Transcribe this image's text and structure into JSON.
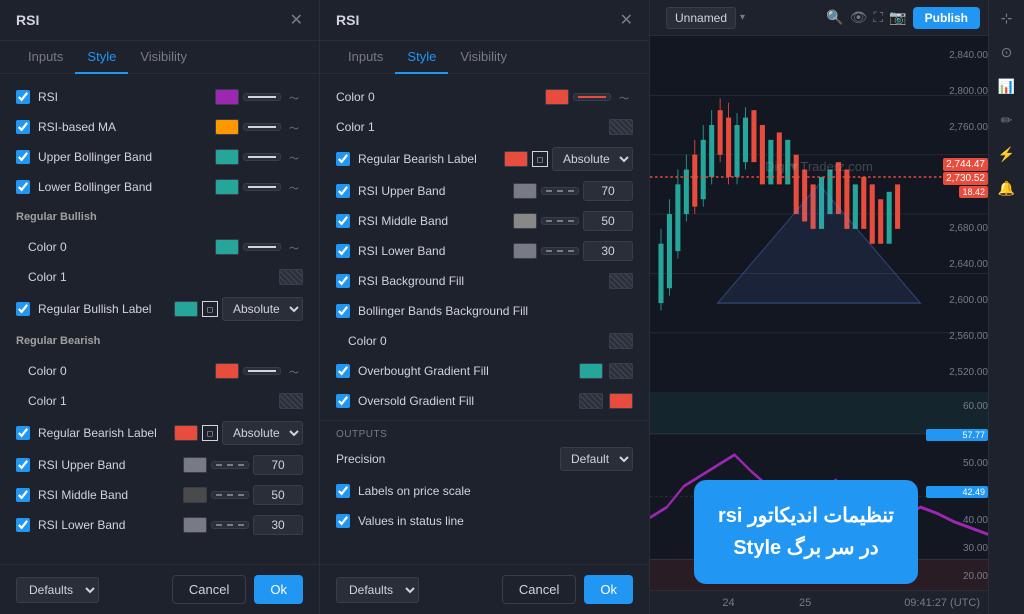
{
  "leftPanel": {
    "title": "RSI",
    "tabs": [
      "Inputs",
      "Style",
      "Visibility"
    ],
    "activeTab": "Style",
    "rows": [
      {
        "type": "checkbox-color",
        "checked": true,
        "label": "RSI",
        "color": "purple",
        "lineStyle": "solid",
        "hasWavy": true
      },
      {
        "type": "checkbox-color",
        "checked": true,
        "label": "RSI-based MA",
        "color": "orange",
        "lineStyle": "solid",
        "hasWavy": true
      },
      {
        "type": "checkbox-color",
        "checked": true,
        "label": "Upper Bollinger Band",
        "color": "green",
        "lineStyle": "solid",
        "hasWavy": true
      },
      {
        "type": "checkbox-color",
        "checked": true,
        "label": "Lower Bollinger Band",
        "color": "green",
        "lineStyle": "solid",
        "hasWavy": true
      },
      {
        "type": "section",
        "label": "Regular Bullish"
      },
      {
        "type": "sublabel-color",
        "label": "Color 0",
        "color": "green",
        "lineStyle": "solid",
        "hasWavy": true
      },
      {
        "type": "sublabel-pattern",
        "label": "Color 1"
      },
      {
        "type": "checkbox-color-shape",
        "checked": true,
        "label": "Regular Bullish Label",
        "color": "green",
        "hasShape": true,
        "dropdownValue": "Absolute"
      },
      {
        "type": "section",
        "label": "Regular Bearish"
      },
      {
        "type": "sublabel-color",
        "label": "Color 0",
        "color": "red",
        "lineStyle": "solid",
        "hasWavy": true
      },
      {
        "type": "sublabel-pattern",
        "label": "Color 1"
      },
      {
        "type": "checkbox-color-shape",
        "checked": true,
        "label": "Regular Bearish Label",
        "color": "red",
        "hasShape": true,
        "dropdownValue": "Absolute"
      },
      {
        "type": "checkbox-number",
        "checked": true,
        "label": "RSI Upper Band",
        "color": "gray",
        "lineStyle": "dashed",
        "number": "70"
      },
      {
        "type": "checkbox-number",
        "checked": true,
        "label": "RSI Middle Band",
        "color": "gray",
        "lineStyle": "dashed",
        "number": "50"
      },
      {
        "type": "checkbox-number",
        "checked": true,
        "label": "RSI Lower Band",
        "color": "gray",
        "lineStyle": "dashed",
        "number": "30"
      }
    ],
    "footer": {
      "defaultsLabel": "Defaults",
      "cancelLabel": "Cancel",
      "okLabel": "Ok"
    }
  },
  "rightPanel": {
    "title": "RSI",
    "tabs": [
      "Inputs",
      "Style",
      "Visibility"
    ],
    "activeTab": "Style",
    "rows": [
      {
        "type": "color-line",
        "label": "Color 0",
        "color": "red",
        "lineStyle": "solid",
        "hasWavy": true
      },
      {
        "type": "color-pattern",
        "label": "Color 1"
      },
      {
        "type": "checkbox-color-shape",
        "checked": true,
        "label": "Regular Bearish Label",
        "color": "red",
        "hasShape": true,
        "dropdownValue": "Absolute"
      },
      {
        "type": "checkbox-number",
        "checked": true,
        "label": "RSI Upper Band",
        "color": "gray",
        "lineStyle": "dashed",
        "number": "70"
      },
      {
        "type": "checkbox-number",
        "checked": true,
        "label": "RSI Middle Band",
        "color": "lightgray",
        "lineStyle": "dashed",
        "number": "50"
      },
      {
        "type": "checkbox-number",
        "checked": true,
        "label": "RSI Lower Band",
        "color": "gray",
        "lineStyle": "dashed",
        "number": "30"
      },
      {
        "type": "checkbox-pattern",
        "checked": true,
        "label": "RSI Background Fill"
      },
      {
        "type": "section",
        "label": "Bollinger Bands Background Fill"
      },
      {
        "type": "sublabel-pattern",
        "label": "Color 0"
      },
      {
        "type": "checkbox-pattern",
        "checked": true,
        "label": "Overbought Gradient Fill",
        "color": "green"
      },
      {
        "type": "checkbox-pattern-red",
        "checked": true,
        "label": "Oversold Gradient Fill",
        "color": "red"
      }
    ],
    "outputs": {
      "sectionLabel": "OUTPUTS",
      "precision": {
        "label": "Precision",
        "value": "Default"
      },
      "labelsOnPriceScale": {
        "label": "Labels on price scale",
        "checked": true
      },
      "valuesInStatusLine": {
        "label": "Values in status line",
        "checked": true
      }
    },
    "footer": {
      "defaultsLabel": "Defaults",
      "cancelLabel": "Cancel",
      "okLabel": "Ok"
    }
  },
  "topbar": {
    "unnamed": "Unnamed",
    "publishLabel": "Publish"
  },
  "overlay": {
    "line1": "تنظیمات اندیکاتور rsi",
    "line2": "در سر برگ Style"
  },
  "priceLabels": [
    "2,840.00",
    "2,800.00",
    "2,760.00",
    "2,744.47",
    "2,730.52",
    "18.42",
    "2,680.00",
    "2,640.00",
    "2,600.00",
    "2,560.00",
    "2,520.00"
  ],
  "rsiLabels": [
    "60.00",
    "57.77",
    "50.00",
    "42.49",
    "40.00",
    "30.00",
    "20.00"
  ],
  "chartFooter": {
    "time": "09:41:27 (UTC)",
    "dates": [
      "24",
      "25"
    ]
  }
}
